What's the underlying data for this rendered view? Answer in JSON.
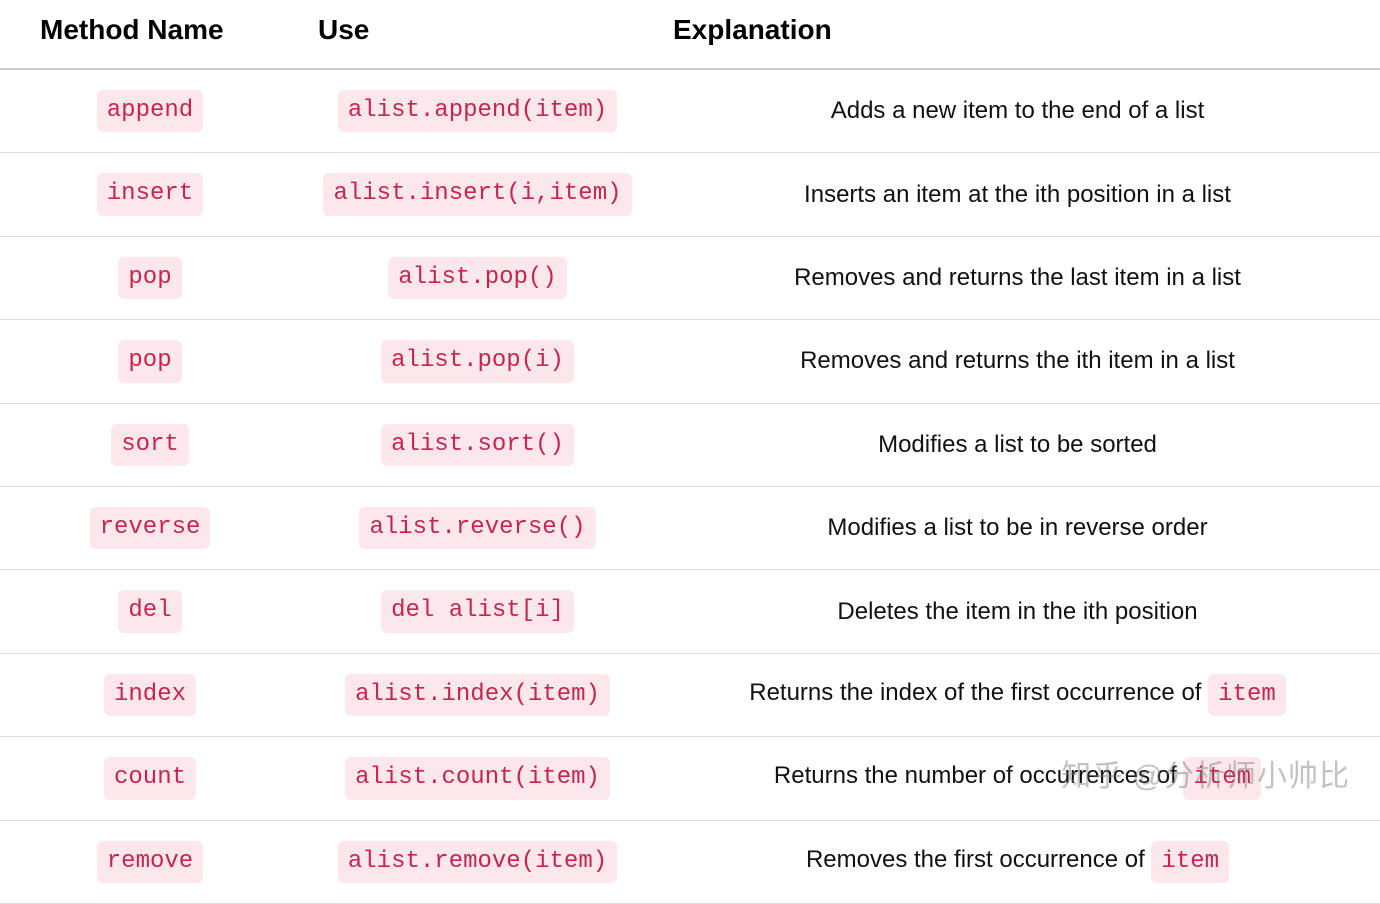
{
  "table": {
    "headers": {
      "method": "Method Name",
      "use": "Use",
      "explanation": "Explanation"
    },
    "rows": [
      {
        "method": "append",
        "use": "alist.append(item)",
        "explanation_prefix": "Adds a new item to the end of a list",
        "explanation_code": null
      },
      {
        "method": "insert",
        "use": "alist.insert(i,item)",
        "explanation_prefix": "Inserts an item at the ith position in a list",
        "explanation_code": null
      },
      {
        "method": "pop",
        "use": "alist.pop()",
        "explanation_prefix": "Removes and returns the last item in a list",
        "explanation_code": null
      },
      {
        "method": "pop",
        "use": "alist.pop(i)",
        "explanation_prefix": "Removes and returns the ith item in a list",
        "explanation_code": null
      },
      {
        "method": "sort",
        "use": "alist.sort()",
        "explanation_prefix": "Modifies a list to be sorted",
        "explanation_code": null
      },
      {
        "method": "reverse",
        "use": "alist.reverse()",
        "explanation_prefix": "Modifies a list to be in reverse order",
        "explanation_code": null
      },
      {
        "method": "del",
        "use": "del alist[i]",
        "explanation_prefix": "Deletes the item in the ith position",
        "explanation_code": null
      },
      {
        "method": "index",
        "use": "alist.index(item)",
        "explanation_prefix": "Returns the index of the first occurrence of ",
        "explanation_code": "item"
      },
      {
        "method": "count",
        "use": "alist.count(item)",
        "explanation_prefix": "Returns the number of occurrences of ",
        "explanation_code": "item"
      },
      {
        "method": "remove",
        "use": "alist.remove(item)",
        "explanation_prefix": "Removes the first occurrence of ",
        "explanation_code": "item"
      }
    ]
  },
  "watermark": "知乎 @分析师小帅比"
}
